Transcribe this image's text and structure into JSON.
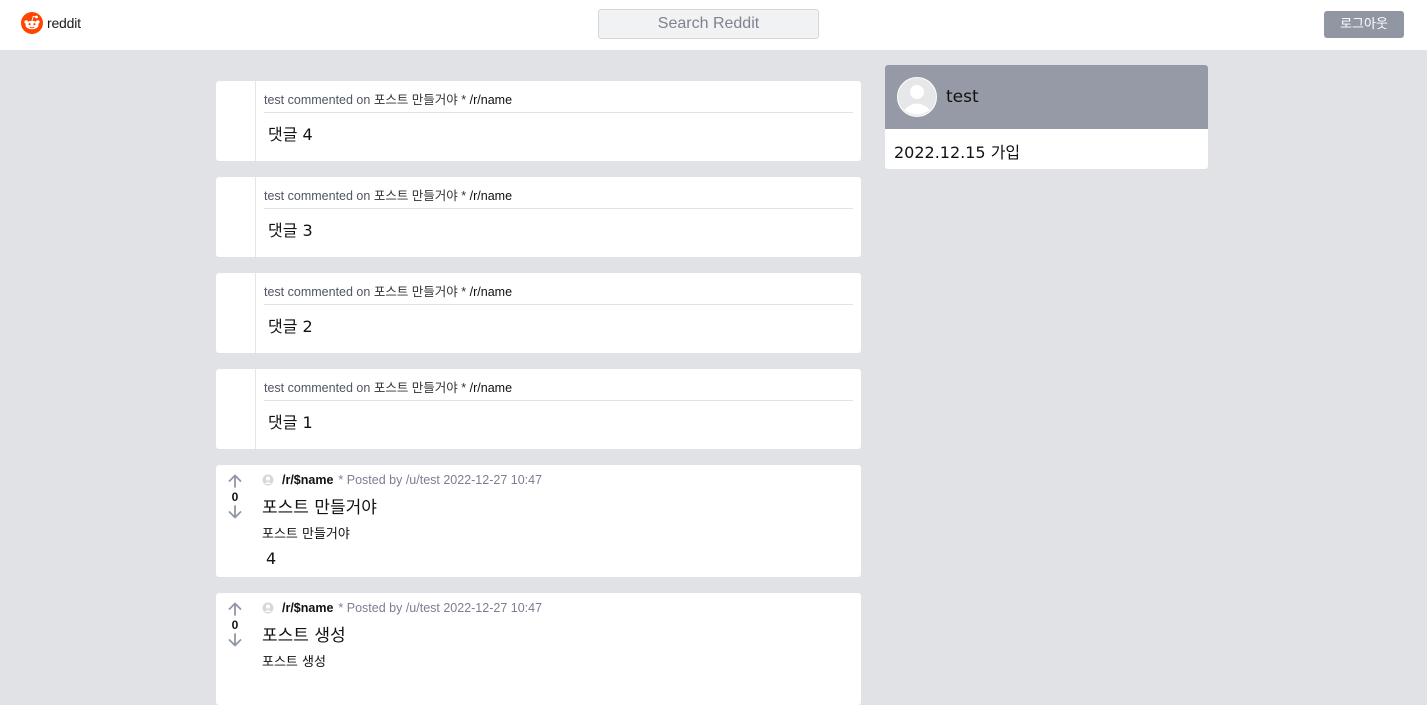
{
  "header": {
    "logo_text": "reddit",
    "search_placeholder": "Search Reddit",
    "logout_label": "로그아웃"
  },
  "comments": [
    {
      "user": "test",
      "action": "commented on",
      "post_title": "포스트 만들거야",
      "separator": "*",
      "subreddit": "/r/name",
      "text": "댓글 4"
    },
    {
      "user": "test",
      "action": "commented on",
      "post_title": "포스트 만들거야",
      "separator": "*",
      "subreddit": "/r/name",
      "text": "댓글 3"
    },
    {
      "user": "test",
      "action": "commented on",
      "post_title": "포스트 만들거야",
      "separator": "*",
      "subreddit": "/r/name",
      "text": "댓글 2"
    },
    {
      "user": "test",
      "action": "commented on",
      "post_title": "포스트 만들거야",
      "separator": "*",
      "subreddit": "/r/name",
      "text": "댓글 1"
    }
  ],
  "posts": [
    {
      "votes": "0",
      "subreddit": "/r/$name",
      "posted_by": "* Posted by /u/test 2022-12-27 10:47",
      "title": "포스트 만들거야",
      "body": "포스트 만들거야",
      "count": "4"
    },
    {
      "votes": "0",
      "subreddit": "/r/$name",
      "posted_by": "* Posted by /u/test 2022-12-27 10:47",
      "title": "포스트 생성",
      "body": "포스트 생성",
      "count": ""
    }
  ],
  "profile": {
    "username": "test",
    "joined": "2022.12.15 가입"
  },
  "colors": {
    "page_bg": "#e1e2e6",
    "brand": "#ff4500",
    "button_bg": "#9097a3",
    "profile_header": "#959aa6"
  },
  "icons": [
    "reddit-logo-icon",
    "upvote-arrow-icon",
    "downvote-arrow-icon",
    "user-avatar-icon"
  ]
}
